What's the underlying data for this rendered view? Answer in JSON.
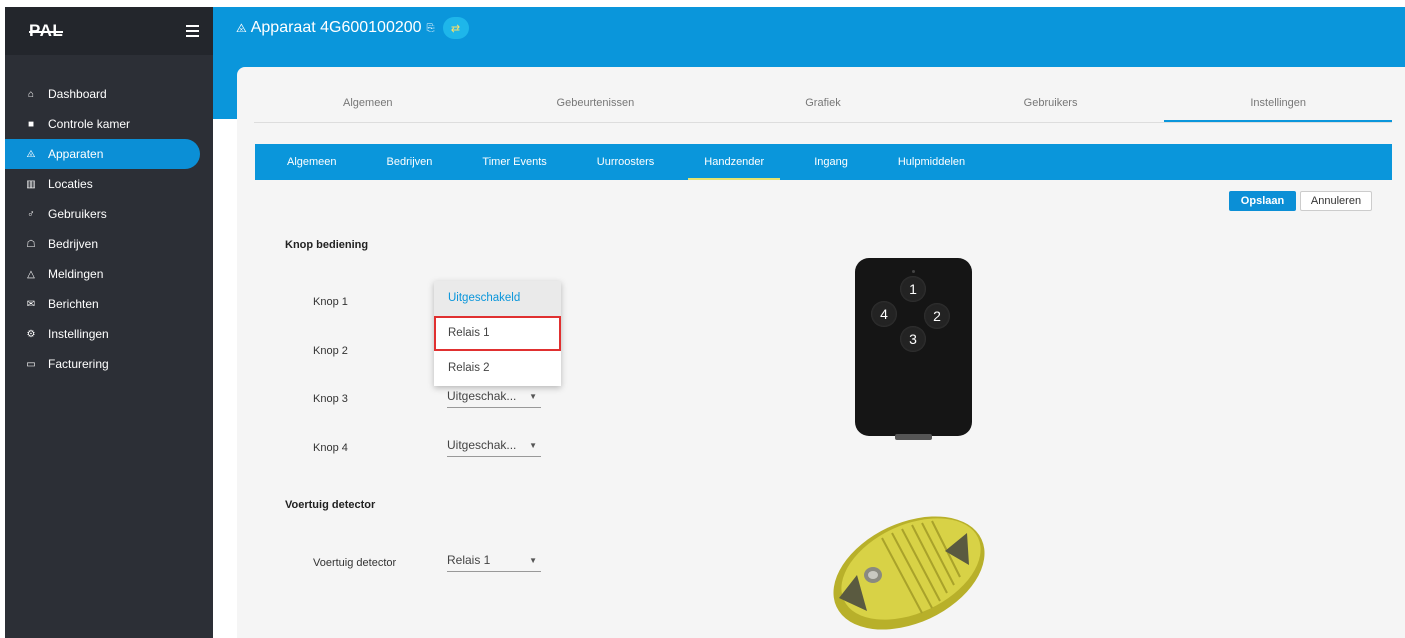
{
  "sidebar": {
    "logo": "PAL",
    "items": [
      {
        "label": "Dashboard",
        "icon": "home-icon",
        "glyph": "⌂"
      },
      {
        "label": "Controle kamer",
        "icon": "building-icon",
        "glyph": "■"
      },
      {
        "label": "Apparaten",
        "icon": "router-icon",
        "glyph": "⨻",
        "active": true
      },
      {
        "label": "Locaties",
        "icon": "map-icon",
        "glyph": "▥"
      },
      {
        "label": "Gebruikers",
        "icon": "user-icon",
        "glyph": "♂"
      },
      {
        "label": "Bedrijven",
        "icon": "briefcase-icon",
        "glyph": "☖"
      },
      {
        "label": "Meldingen",
        "icon": "bell-icon",
        "glyph": "△"
      },
      {
        "label": "Berichten",
        "icon": "envelope-icon",
        "glyph": "✉"
      },
      {
        "label": "Instellingen",
        "icon": "gear-icon",
        "glyph": "⚙"
      },
      {
        "label": "Facturering",
        "icon": "credit-card-icon",
        "glyph": "▭"
      }
    ]
  },
  "header": {
    "device_title": "Apparaat 4G600100200"
  },
  "main_tabs": [
    "Algemeen",
    "Gebeurtenissen",
    "Grafiek",
    "Gebruikers",
    "Instellingen"
  ],
  "sub_tabs": [
    "Algemeen",
    "Bedrijven",
    "Timer Events",
    "Uurroosters",
    "Handzender",
    "Ingang",
    "Hulpmiddelen"
  ],
  "actions": {
    "save": "Opslaan",
    "cancel": "Annuleren"
  },
  "knop_section": {
    "title": "Knop bediening",
    "fields": [
      {
        "label": "Knop 1",
        "value": "Uitgeschakeld"
      },
      {
        "label": "Knop 2",
        "value": "Relais 1"
      },
      {
        "label": "Knop 3",
        "value": "Uitgeschak..."
      },
      {
        "label": "Knop 4",
        "value": "Uitgeschak..."
      }
    ]
  },
  "dropdown": {
    "options": [
      "Uitgeschakeld",
      "Relais 1",
      "Relais 2"
    ],
    "selected_index": 0,
    "highlighted_index": 1
  },
  "voertuig_section": {
    "title": "Voertuig detector",
    "field": {
      "label": "Voertuig detector",
      "value": "Relais 1"
    }
  },
  "remote": {
    "buttons": [
      "1",
      "2",
      "3",
      "4"
    ]
  },
  "colors": {
    "accent": "#0a96db",
    "sidebar": "#2c2f36",
    "highlight": "#e03030",
    "tab_underline": "#e6e36e"
  }
}
